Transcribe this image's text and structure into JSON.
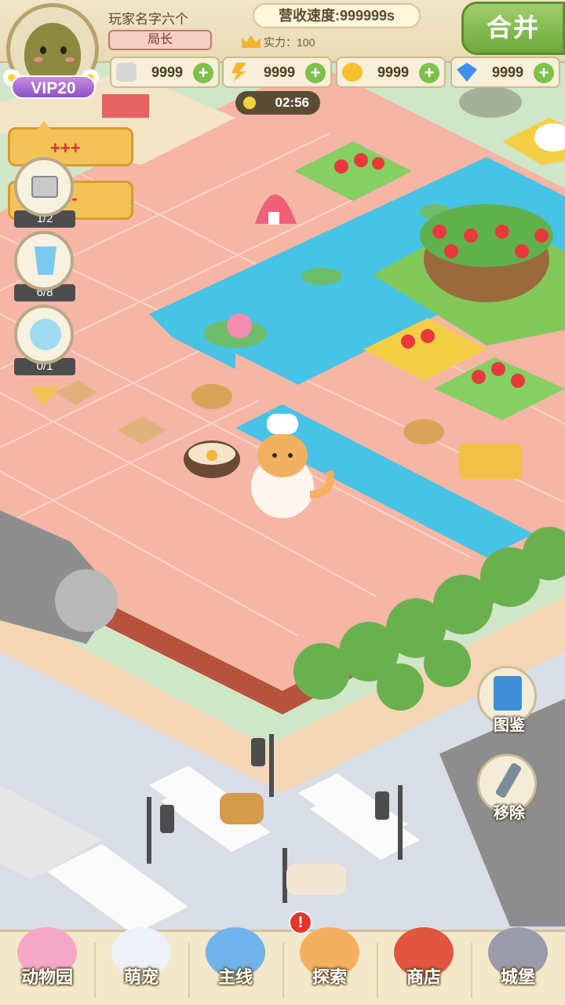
{
  "player": {
    "name": "玩家名字六个",
    "rank": "局长",
    "power_label": "实力：100",
    "vip": "VIP20"
  },
  "hud": {
    "revenue": "营收速度:999999s",
    "merge_label": "合并",
    "timer": "02:56"
  },
  "resources": [
    {
      "icon": "cat-food-icon",
      "value": "9999"
    },
    {
      "icon": "lightning-icon",
      "value": "9999"
    },
    {
      "icon": "coin-icon",
      "value": "9999"
    },
    {
      "icon": "gem-icon",
      "value": "9999"
    }
  ],
  "side": {
    "plus_marker": "+++",
    "minus_marker": "--",
    "tasks": [
      {
        "icon": "treasure-chest-icon",
        "progress": "1/2"
      },
      {
        "icon": "water-glass-icon",
        "progress": "6/8"
      },
      {
        "icon": "bubble-cat-icon",
        "progress": "0/1"
      }
    ]
  },
  "right_buttons": {
    "codex": "图鉴",
    "remove": "移除"
  },
  "nav": [
    {
      "label": "动物园",
      "icon": "zoo-icon"
    },
    {
      "label": "萌宠",
      "icon": "pets-icon"
    },
    {
      "label": "主线",
      "icon": "main-quest-icon"
    },
    {
      "label": "探索",
      "icon": "explore-icon"
    },
    {
      "label": "商店",
      "icon": "shop-icon"
    },
    {
      "label": "城堡",
      "icon": "castle-icon"
    }
  ],
  "nav_badge": "!",
  "colors": {
    "tile": "#f4b7a8",
    "water": "#47c3e6",
    "grass": "#8ccf5b",
    "accent_green": "#7fc04b"
  }
}
